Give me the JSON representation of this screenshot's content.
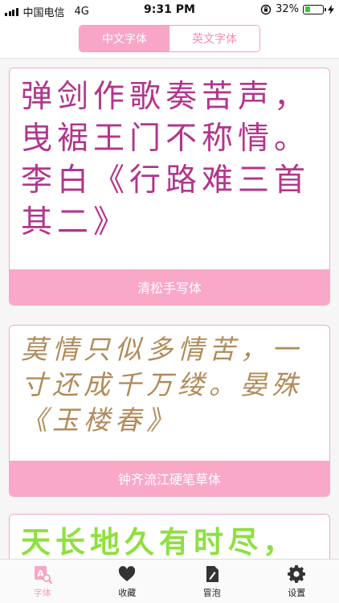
{
  "status_bar": {
    "carrier": "中国电信",
    "network": "4G",
    "time": "9:31 PM",
    "battery": "32%",
    "battery_level": 0.32
  },
  "segment": {
    "tabs": [
      {
        "label": "中文字体",
        "active": true
      },
      {
        "label": "英文字体",
        "active": false
      }
    ]
  },
  "fonts": [
    {
      "sample": "弹剑作歌奏苦声，曳裾王门不称情。李白《行路难三首其二》",
      "name": "清松手写体",
      "color": "#b2358d"
    },
    {
      "sample": "莫情只似多情苦，一寸还成千万缕。晏殊《玉楼春》",
      "name": "钟齐流江硬笔草体",
      "color": "#b28b5a"
    },
    {
      "sample": "天长地久有时尽，",
      "name": "",
      "color": "#8ee03f"
    }
  ],
  "tabbar": {
    "items": [
      {
        "label": "字体",
        "icon": "font-search-icon",
        "active": true
      },
      {
        "label": "收藏",
        "icon": "heart-icon",
        "active": false
      },
      {
        "label": "冒泡",
        "icon": "note-icon",
        "active": false
      },
      {
        "label": "设置",
        "icon": "gear-icon",
        "active": false
      }
    ]
  },
  "colors": {
    "accent": "#f7a6c6",
    "accent_text": "#f08db5"
  }
}
